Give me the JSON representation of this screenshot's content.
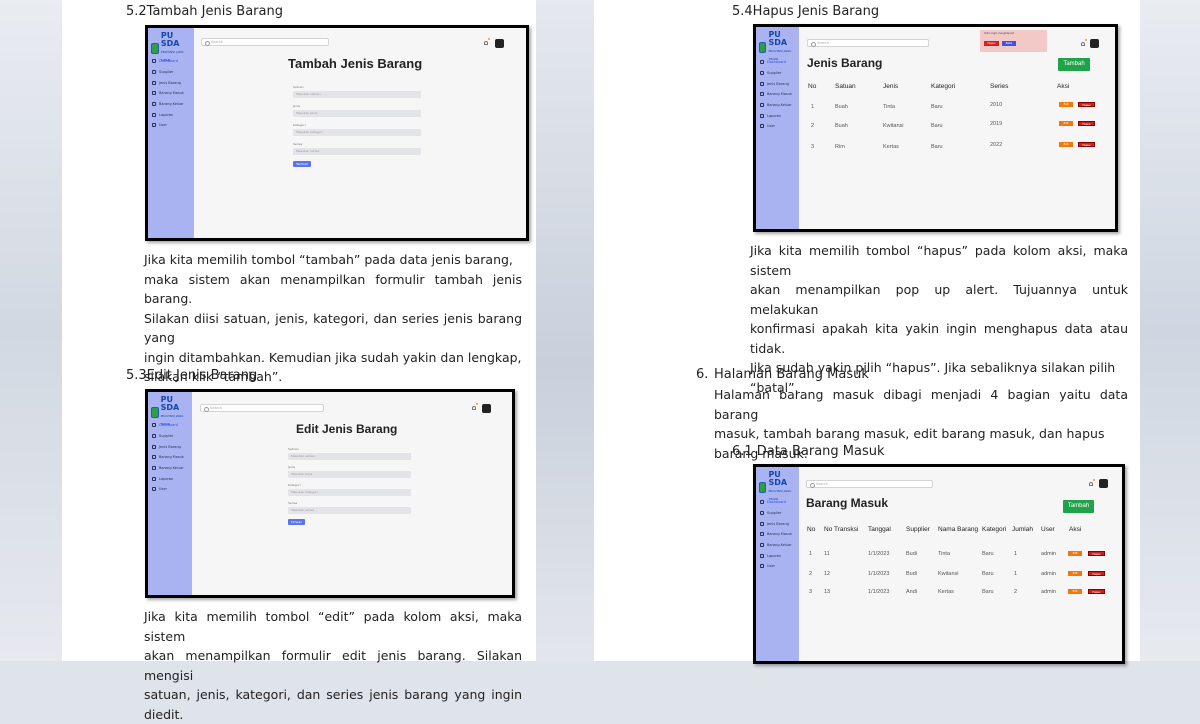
{
  "left_page": {
    "s52": {
      "heading": "5.2Tambah Jenis Barang",
      "paragraph": [
        "Jika kita memilih tombol “tambah” pada data jenis barang,",
        "maka sistem akan menampilkan formulir tambah jenis barang.",
        "Silakan diisi satuan, jenis, kategori, dan series jenis barang yang",
        "ingin ditambahkan. Kemudian jika sudah yakin dan lengkap,",
        "silakan klik “tambah”."
      ],
      "shot": {
        "title": "Tambah Jenis Barang",
        "search": "Search",
        "fields": [
          {
            "label": "Satuan",
            "placeholder": "Masukan satuan"
          },
          {
            "label": "Jenis",
            "placeholder": "Masukan Jenis"
          },
          {
            "label": "Kategori",
            "placeholder": "Masukan kategori"
          },
          {
            "label": "Series",
            "placeholder": "Masukan series"
          }
        ],
        "submit": "Tambah"
      }
    },
    "s53": {
      "heading": "5.3Edit Jenis Barang",
      "paragraph": [
        "Jika kita memilih tombol “edit” pada kolom aksi, maka sistem",
        "akan menampilkan formulir edit jenis barang. Silakan mengisi",
        "satuan, jenis, kategori, dan series jenis barang yang ingin diedit."
      ],
      "shot": {
        "title": "Edit Jenis Barang",
        "search": "Search",
        "fields": [
          {
            "label": "Satuan",
            "placeholder": "Masukan satuan"
          },
          {
            "label": "Jenis",
            "placeholder": "Masukan Jenis"
          },
          {
            "label": "Kategori",
            "placeholder": "Masukan kategori"
          },
          {
            "label": "Series",
            "placeholder": "Masukan series"
          }
        ],
        "submit": "Simpan"
      }
    }
  },
  "right_page": {
    "s54": {
      "heading": "5.4Hapus Jenis Barang",
      "paragraph": [
        "Jika kita memilih tombol “hapus” pada kolom aksi, maka sistem",
        "akan menampilkan pop up alert. Tujuannya untuk melakukan",
        "konfirmasi apakah kita yakin ingin menghapus data atau tidak.",
        "Jika sudah yakin pilih “hapus”. Jika sebaliknya silakan pilih",
        "“batal”."
      ],
      "shot": {
        "title": "Jenis Barang",
        "add_button": "Tambah",
        "search": "Search",
        "alert": {
          "text": "Yakin ingin menghapus?",
          "confirm": "Hapus",
          "cancel": "Batal"
        },
        "columns": [
          "No",
          "Satuan",
          "Jenis",
          "Kategori",
          "Series",
          "Aksi"
        ],
        "rows": [
          [
            "1",
            "Buah",
            "Tinta",
            "Baru",
            "2010"
          ],
          [
            "2",
            "Buah",
            "Kwitansi",
            "Baru",
            "2019"
          ],
          [
            "3",
            "Rim",
            "Kertas",
            "Baru",
            "2022"
          ]
        ],
        "edit_label": "Edit",
        "delete_label": "Hapus"
      }
    },
    "s6": {
      "heading_num": "6.",
      "heading": "Halaman Barang Masuk",
      "paragraph": [
        "Halaman barang masuk dibagi menjadi 4 bagian yaitu data barang",
        "masuk, tambah barang masuk, edit barang masuk, dan hapus",
        "barang masuk."
      ]
    },
    "s61": {
      "heading": "6.1 Data Barang Masuk",
      "shot": {
        "title": "Barang Masuk",
        "add_button": "Tambah",
        "search": "Search",
        "columns": [
          "No",
          "No Transksi",
          "Tanggal",
          "Supplier",
          "Nama Barang",
          "Kategori",
          "Jumlah",
          "User",
          "Aksi"
        ],
        "rows": [
          [
            "1",
            "11",
            "1/1/2023",
            "Budi",
            "Tinta",
            "Baru",
            "1",
            "admin"
          ],
          [
            "2",
            "12",
            "1/1/2023",
            "Budi",
            "Kwitansi",
            "Baru",
            "1",
            "admin"
          ],
          [
            "3",
            "13",
            "1/1/2023",
            "Andi",
            "Kertas",
            "Baru",
            "2",
            "admin"
          ]
        ],
        "edit_label": "Edit",
        "delete_label": "Hapus"
      }
    }
  },
  "sidebar": {
    "logo": "PU SDA",
    "logo_sub": "PROVINSI JAWA TIMUR",
    "items": [
      "Dashboard",
      "Supplier",
      "Jenis Barang",
      "Barang Masuk",
      "Barang Keluar",
      "Laporan",
      "User"
    ]
  },
  "colors": {
    "sidebar": "#aab3f2",
    "add_button": "#1fa24a",
    "edit_button": "#f0790c",
    "delete_button": "#c8221f",
    "submit_button": "#5b74ee"
  }
}
